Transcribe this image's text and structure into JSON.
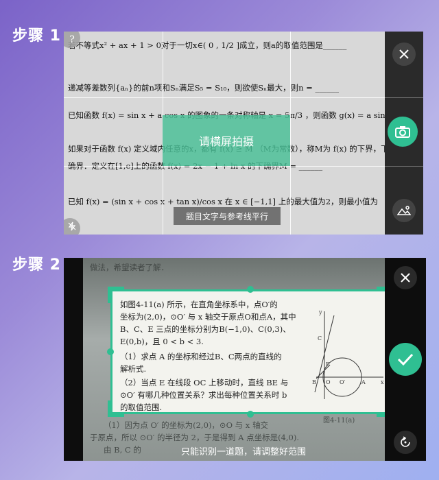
{
  "step1": {
    "title": "步骤 1",
    "doc_lines": [
      "若不等式x² + ax + 1 > 0对于一切x∈( 0 ,  1/2 ]成立，则a的取值范围是______",
      "递减等差数列{aₙ}的前n项和Sₙ满足S₅ = S₁₀，则欲使Sₙ最大，则n = ______",
      "已知函数 f(x) = sin x + a cos x 的图象的一条对称轴是 x = 5π/3 ，则函数 g(x) = a sin x + cos x 的初相",
      "如果对于函数 f(x) 定义域内任意的x，都有 f(x) ≥ M （M为常数），称M为 f(x) 的下界，下界M中的最",
      "确界．定义在[1,e]上的函数 f(x) = 2x − 1 + ln x 的下确界M = ______",
      "已知 f(x) = (sin x + cos x + tan x)/cos x  在 x ∈ [−1,1] 上的最大值为2，则最小值为"
    ],
    "rotate_hint": "请横屏拍摄",
    "align_hint": "题目文字与参考线平行",
    "help_icon": "?",
    "flash_icon": "flash-off",
    "close_icon": "close",
    "capture_icon": "camera",
    "album_icon": "album"
  },
  "step2": {
    "title": "步骤 2",
    "top_faded": "做法，希望读者了解．",
    "problem_lines": [
      "如图4-11(a) 所示，在直角坐标系中，点O′的",
      "坐标为(2,0)，⊙O′ 与 x 轴交于原点O和点A，其中",
      "B、C、E 三点的坐标分别为B(−1,0)、C(0,3)、",
      "E(0,b)，且 0 < b < 3.",
      "（1）求点 A 的坐标和经过B、C两点的直线的",
      "解析式.",
      "（2）当点 E 在线段 OC 上移动时，直线 BE 与",
      "⊙O′ 有哪几种位置关系？求出每种位置关系时 b",
      "的取值范围."
    ],
    "bottom_faded": [
      "（1）因为点 O′ 的坐标为(2,0)，⊙O 与 x 轴交",
      "于原点，所以 ⊙O′ 的半径为 2，于是得到 A 点坐标是(4,0).",
      "由 B, C 的"
    ],
    "figure_label": "图4-11(a)",
    "bottom_hint": "只能识别一道题，请调整好范围",
    "close_icon": "close",
    "confirm_icon": "check",
    "rotate_icon": "rotate"
  },
  "colors": {
    "accent": "#2fbf92",
    "panel_dark": "#2a2a2a"
  }
}
